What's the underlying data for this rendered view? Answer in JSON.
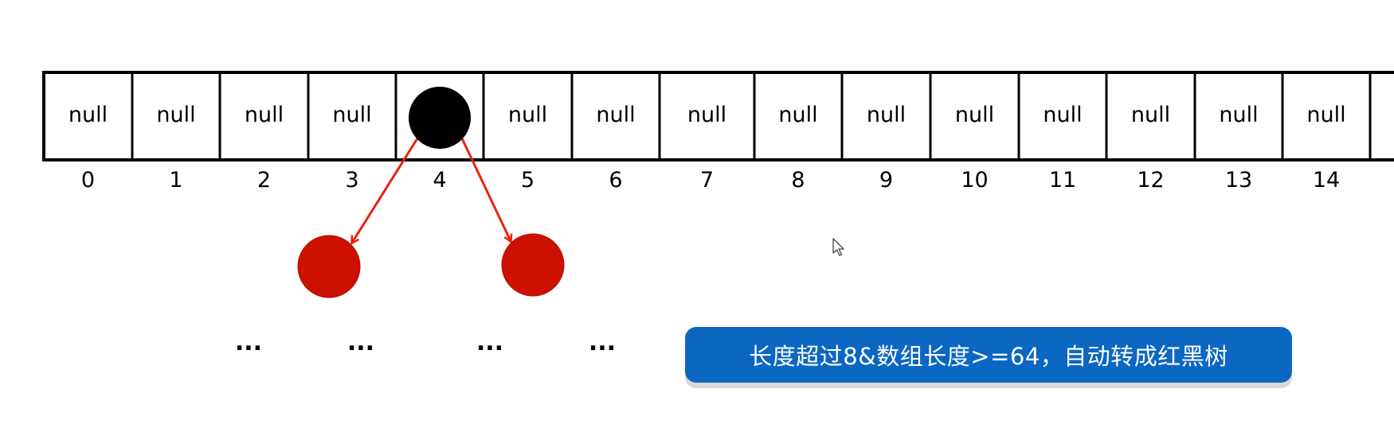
{
  "array": {
    "cells": [
      "null",
      "null",
      "null",
      "null",
      "",
      "null",
      "null",
      "null",
      "null",
      "null",
      "null",
      "null",
      "null",
      "null",
      "null"
    ],
    "indices": [
      "0",
      "1",
      "2",
      "3",
      "4",
      "5",
      "6",
      "7",
      "8",
      "9",
      "10",
      "11",
      "12",
      "13",
      "14"
    ]
  },
  "tree": {
    "root_color": "#000000",
    "child_color": "#cc1100",
    "arrow_color": "#e8240c"
  },
  "ellipses": [
    "...",
    "...",
    "...",
    "..."
  ],
  "note": {
    "text": "长度超过8&数组长度>=64，自动转成红黑树",
    "background": "#0b67c2"
  }
}
